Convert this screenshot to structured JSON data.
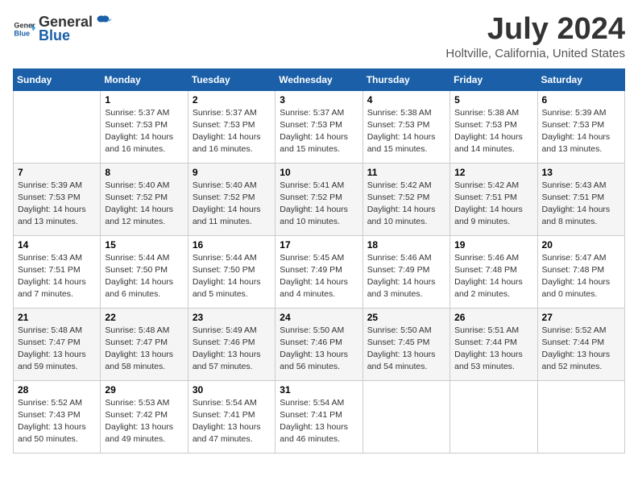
{
  "header": {
    "logo_general": "General",
    "logo_blue": "Blue",
    "title": "July 2024",
    "subtitle": "Holtville, California, United States"
  },
  "weekdays": [
    "Sunday",
    "Monday",
    "Tuesday",
    "Wednesday",
    "Thursday",
    "Friday",
    "Saturday"
  ],
  "weeks": [
    [
      {
        "day": "",
        "info": ""
      },
      {
        "day": "1",
        "info": "Sunrise: 5:37 AM\nSunset: 7:53 PM\nDaylight: 14 hours\nand 16 minutes."
      },
      {
        "day": "2",
        "info": "Sunrise: 5:37 AM\nSunset: 7:53 PM\nDaylight: 14 hours\nand 16 minutes."
      },
      {
        "day": "3",
        "info": "Sunrise: 5:37 AM\nSunset: 7:53 PM\nDaylight: 14 hours\nand 15 minutes."
      },
      {
        "day": "4",
        "info": "Sunrise: 5:38 AM\nSunset: 7:53 PM\nDaylight: 14 hours\nand 15 minutes."
      },
      {
        "day": "5",
        "info": "Sunrise: 5:38 AM\nSunset: 7:53 PM\nDaylight: 14 hours\nand 14 minutes."
      },
      {
        "day": "6",
        "info": "Sunrise: 5:39 AM\nSunset: 7:53 PM\nDaylight: 14 hours\nand 13 minutes."
      }
    ],
    [
      {
        "day": "7",
        "info": "Sunrise: 5:39 AM\nSunset: 7:53 PM\nDaylight: 14 hours\nand 13 minutes."
      },
      {
        "day": "8",
        "info": "Sunrise: 5:40 AM\nSunset: 7:52 PM\nDaylight: 14 hours\nand 12 minutes."
      },
      {
        "day": "9",
        "info": "Sunrise: 5:40 AM\nSunset: 7:52 PM\nDaylight: 14 hours\nand 11 minutes."
      },
      {
        "day": "10",
        "info": "Sunrise: 5:41 AM\nSunset: 7:52 PM\nDaylight: 14 hours\nand 10 minutes."
      },
      {
        "day": "11",
        "info": "Sunrise: 5:42 AM\nSunset: 7:52 PM\nDaylight: 14 hours\nand 10 minutes."
      },
      {
        "day": "12",
        "info": "Sunrise: 5:42 AM\nSunset: 7:51 PM\nDaylight: 14 hours\nand 9 minutes."
      },
      {
        "day": "13",
        "info": "Sunrise: 5:43 AM\nSunset: 7:51 PM\nDaylight: 14 hours\nand 8 minutes."
      }
    ],
    [
      {
        "day": "14",
        "info": "Sunrise: 5:43 AM\nSunset: 7:51 PM\nDaylight: 14 hours\nand 7 minutes."
      },
      {
        "day": "15",
        "info": "Sunrise: 5:44 AM\nSunset: 7:50 PM\nDaylight: 14 hours\nand 6 minutes."
      },
      {
        "day": "16",
        "info": "Sunrise: 5:44 AM\nSunset: 7:50 PM\nDaylight: 14 hours\nand 5 minutes."
      },
      {
        "day": "17",
        "info": "Sunrise: 5:45 AM\nSunset: 7:49 PM\nDaylight: 14 hours\nand 4 minutes."
      },
      {
        "day": "18",
        "info": "Sunrise: 5:46 AM\nSunset: 7:49 PM\nDaylight: 14 hours\nand 3 minutes."
      },
      {
        "day": "19",
        "info": "Sunrise: 5:46 AM\nSunset: 7:48 PM\nDaylight: 14 hours\nand 2 minutes."
      },
      {
        "day": "20",
        "info": "Sunrise: 5:47 AM\nSunset: 7:48 PM\nDaylight: 14 hours\nand 0 minutes."
      }
    ],
    [
      {
        "day": "21",
        "info": "Sunrise: 5:48 AM\nSunset: 7:47 PM\nDaylight: 13 hours\nand 59 minutes."
      },
      {
        "day": "22",
        "info": "Sunrise: 5:48 AM\nSunset: 7:47 PM\nDaylight: 13 hours\nand 58 minutes."
      },
      {
        "day": "23",
        "info": "Sunrise: 5:49 AM\nSunset: 7:46 PM\nDaylight: 13 hours\nand 57 minutes."
      },
      {
        "day": "24",
        "info": "Sunrise: 5:50 AM\nSunset: 7:46 PM\nDaylight: 13 hours\nand 56 minutes."
      },
      {
        "day": "25",
        "info": "Sunrise: 5:50 AM\nSunset: 7:45 PM\nDaylight: 13 hours\nand 54 minutes."
      },
      {
        "day": "26",
        "info": "Sunrise: 5:51 AM\nSunset: 7:44 PM\nDaylight: 13 hours\nand 53 minutes."
      },
      {
        "day": "27",
        "info": "Sunrise: 5:52 AM\nSunset: 7:44 PM\nDaylight: 13 hours\nand 52 minutes."
      }
    ],
    [
      {
        "day": "28",
        "info": "Sunrise: 5:52 AM\nSunset: 7:43 PM\nDaylight: 13 hours\nand 50 minutes."
      },
      {
        "day": "29",
        "info": "Sunrise: 5:53 AM\nSunset: 7:42 PM\nDaylight: 13 hours\nand 49 minutes."
      },
      {
        "day": "30",
        "info": "Sunrise: 5:54 AM\nSunset: 7:41 PM\nDaylight: 13 hours\nand 47 minutes."
      },
      {
        "day": "31",
        "info": "Sunrise: 5:54 AM\nSunset: 7:41 PM\nDaylight: 13 hours\nand 46 minutes."
      },
      {
        "day": "",
        "info": ""
      },
      {
        "day": "",
        "info": ""
      },
      {
        "day": "",
        "info": ""
      }
    ]
  ]
}
